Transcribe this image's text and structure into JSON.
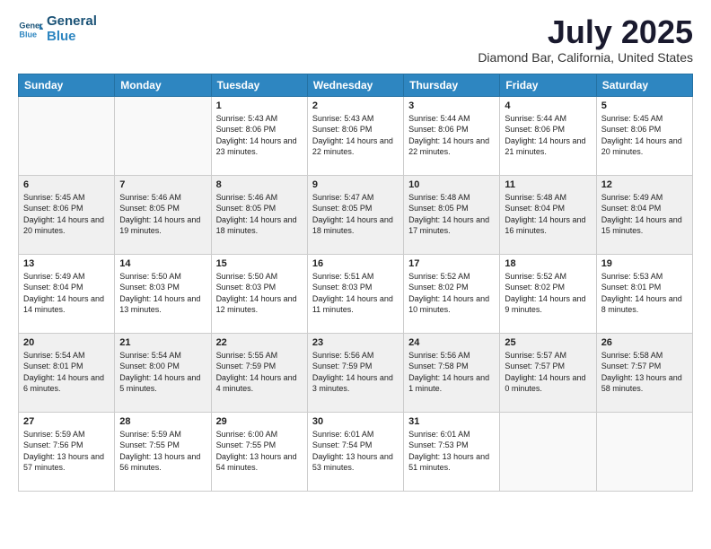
{
  "header": {
    "logo_line1": "General",
    "logo_line2": "Blue",
    "month_title": "July 2025",
    "location": "Diamond Bar, California, United States"
  },
  "days_of_week": [
    "Sunday",
    "Monday",
    "Tuesday",
    "Wednesday",
    "Thursday",
    "Friday",
    "Saturday"
  ],
  "weeks": [
    [
      {
        "day": "",
        "content": ""
      },
      {
        "day": "",
        "content": ""
      },
      {
        "day": "1",
        "content": "Sunrise: 5:43 AM\nSunset: 8:06 PM\nDaylight: 14 hours and 23 minutes."
      },
      {
        "day": "2",
        "content": "Sunrise: 5:43 AM\nSunset: 8:06 PM\nDaylight: 14 hours and 22 minutes."
      },
      {
        "day": "3",
        "content": "Sunrise: 5:44 AM\nSunset: 8:06 PM\nDaylight: 14 hours and 22 minutes."
      },
      {
        "day": "4",
        "content": "Sunrise: 5:44 AM\nSunset: 8:06 PM\nDaylight: 14 hours and 21 minutes."
      },
      {
        "day": "5",
        "content": "Sunrise: 5:45 AM\nSunset: 8:06 PM\nDaylight: 14 hours and 20 minutes."
      }
    ],
    [
      {
        "day": "6",
        "content": "Sunrise: 5:45 AM\nSunset: 8:06 PM\nDaylight: 14 hours and 20 minutes."
      },
      {
        "day": "7",
        "content": "Sunrise: 5:46 AM\nSunset: 8:05 PM\nDaylight: 14 hours and 19 minutes."
      },
      {
        "day": "8",
        "content": "Sunrise: 5:46 AM\nSunset: 8:05 PM\nDaylight: 14 hours and 18 minutes."
      },
      {
        "day": "9",
        "content": "Sunrise: 5:47 AM\nSunset: 8:05 PM\nDaylight: 14 hours and 18 minutes."
      },
      {
        "day": "10",
        "content": "Sunrise: 5:48 AM\nSunset: 8:05 PM\nDaylight: 14 hours and 17 minutes."
      },
      {
        "day": "11",
        "content": "Sunrise: 5:48 AM\nSunset: 8:04 PM\nDaylight: 14 hours and 16 minutes."
      },
      {
        "day": "12",
        "content": "Sunrise: 5:49 AM\nSunset: 8:04 PM\nDaylight: 14 hours and 15 minutes."
      }
    ],
    [
      {
        "day": "13",
        "content": "Sunrise: 5:49 AM\nSunset: 8:04 PM\nDaylight: 14 hours and 14 minutes."
      },
      {
        "day": "14",
        "content": "Sunrise: 5:50 AM\nSunset: 8:03 PM\nDaylight: 14 hours and 13 minutes."
      },
      {
        "day": "15",
        "content": "Sunrise: 5:50 AM\nSunset: 8:03 PM\nDaylight: 14 hours and 12 minutes."
      },
      {
        "day": "16",
        "content": "Sunrise: 5:51 AM\nSunset: 8:03 PM\nDaylight: 14 hours and 11 minutes."
      },
      {
        "day": "17",
        "content": "Sunrise: 5:52 AM\nSunset: 8:02 PM\nDaylight: 14 hours and 10 minutes."
      },
      {
        "day": "18",
        "content": "Sunrise: 5:52 AM\nSunset: 8:02 PM\nDaylight: 14 hours and 9 minutes."
      },
      {
        "day": "19",
        "content": "Sunrise: 5:53 AM\nSunset: 8:01 PM\nDaylight: 14 hours and 8 minutes."
      }
    ],
    [
      {
        "day": "20",
        "content": "Sunrise: 5:54 AM\nSunset: 8:01 PM\nDaylight: 14 hours and 6 minutes."
      },
      {
        "day": "21",
        "content": "Sunrise: 5:54 AM\nSunset: 8:00 PM\nDaylight: 14 hours and 5 minutes."
      },
      {
        "day": "22",
        "content": "Sunrise: 5:55 AM\nSunset: 7:59 PM\nDaylight: 14 hours and 4 minutes."
      },
      {
        "day": "23",
        "content": "Sunrise: 5:56 AM\nSunset: 7:59 PM\nDaylight: 14 hours and 3 minutes."
      },
      {
        "day": "24",
        "content": "Sunrise: 5:56 AM\nSunset: 7:58 PM\nDaylight: 14 hours and 1 minute."
      },
      {
        "day": "25",
        "content": "Sunrise: 5:57 AM\nSunset: 7:57 PM\nDaylight: 14 hours and 0 minutes."
      },
      {
        "day": "26",
        "content": "Sunrise: 5:58 AM\nSunset: 7:57 PM\nDaylight: 13 hours and 58 minutes."
      }
    ],
    [
      {
        "day": "27",
        "content": "Sunrise: 5:59 AM\nSunset: 7:56 PM\nDaylight: 13 hours and 57 minutes."
      },
      {
        "day": "28",
        "content": "Sunrise: 5:59 AM\nSunset: 7:55 PM\nDaylight: 13 hours and 56 minutes."
      },
      {
        "day": "29",
        "content": "Sunrise: 6:00 AM\nSunset: 7:55 PM\nDaylight: 13 hours and 54 minutes."
      },
      {
        "day": "30",
        "content": "Sunrise: 6:01 AM\nSunset: 7:54 PM\nDaylight: 13 hours and 53 minutes."
      },
      {
        "day": "31",
        "content": "Sunrise: 6:01 AM\nSunset: 7:53 PM\nDaylight: 13 hours and 51 minutes."
      },
      {
        "day": "",
        "content": ""
      },
      {
        "day": "",
        "content": ""
      }
    ]
  ]
}
